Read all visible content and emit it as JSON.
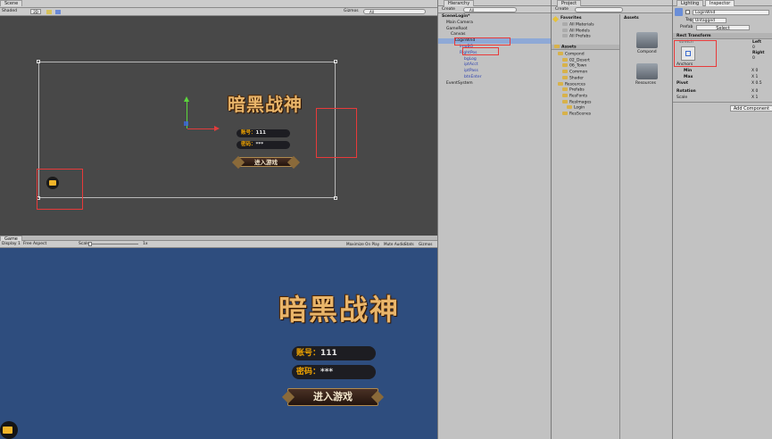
{
  "scene": {
    "tab": "Scene",
    "shading": "Shaded",
    "mode": "2D",
    "gizmos": "Gizmos",
    "search": "All"
  },
  "game": {
    "tab": "Game",
    "display": "Display 1",
    "aspect": "Free Aspect",
    "scale_label": "Scale",
    "scale_value": "1x",
    "toolbar_right": [
      "Maximize On Play",
      "Mute Audio",
      "Stats",
      "Gizmos"
    ]
  },
  "login_ui": {
    "logo": "暗黑战神",
    "account_label": "账号：",
    "account_value": "111",
    "password_label": "密码：",
    "password_value": "***",
    "enter_button": "进入游戏"
  },
  "hierarchy": {
    "tab": "Hierarchy",
    "create": "Create",
    "search": "All",
    "items": [
      {
        "label": "SceneLogin*",
        "depth": 0,
        "kind": "scene"
      },
      {
        "label": "Main Camera",
        "depth": 1
      },
      {
        "label": "GameRoot",
        "depth": 1
      },
      {
        "label": "Canvas",
        "depth": 2
      },
      {
        "label": "LoginWnd",
        "depth": 3,
        "selected": true
      },
      {
        "label": "imgBG",
        "depth": 4
      },
      {
        "label": "RightPos",
        "depth": 4
      },
      {
        "label": "bgLog",
        "depth": 5
      },
      {
        "label": "iptAcct",
        "depth": 5
      },
      {
        "label": "iptPass",
        "depth": 5
      },
      {
        "label": "btnEnter",
        "depth": 5
      },
      {
        "label": "EventSystem",
        "depth": 1
      }
    ]
  },
  "project": {
    "tab": "Project",
    "create": "Create",
    "favorites": "Favorites",
    "favorites_items": [
      "All Materials",
      "All Models",
      "All Prefabs"
    ],
    "assets": "Assets",
    "tree": [
      {
        "label": "Compond",
        "depth": 1
      },
      {
        "label": "02_Desert",
        "depth": 2
      },
      {
        "label": "06_Town",
        "depth": 2
      },
      {
        "label": "Common",
        "depth": 2
      },
      {
        "label": "Shader",
        "depth": 2
      },
      {
        "label": "Resources",
        "depth": 1
      },
      {
        "label": "Prefabs",
        "depth": 2
      },
      {
        "label": "ResFonts",
        "depth": 2
      },
      {
        "label": "ResImages",
        "depth": 2
      },
      {
        "label": "Login",
        "depth": 3
      },
      {
        "label": "ResScenes",
        "depth": 2
      }
    ],
    "grid_header": "Assets",
    "grid_items": [
      "Compond",
      "Resources"
    ]
  },
  "inspector": {
    "tabs": [
      "Lighting",
      "Inspector"
    ],
    "object_name": "LoginWnd",
    "tag_label": "Tag",
    "tag_value": "Untagged",
    "prefab_label": "Prefab",
    "prefab_select": "Select",
    "component": "Rect Transform",
    "stretch_label": "stretch",
    "left": {
      "label": "Left",
      "value": "0"
    },
    "right": {
      "label": "Right",
      "value": "0"
    },
    "top_value": "0",
    "bottom_value": "0",
    "anchors": "Anchors",
    "min": {
      "label": "Min",
      "x": "0",
      "y": "0"
    },
    "max": {
      "label": "Max",
      "x": "1",
      "y": "1"
    },
    "pivot": {
      "label": "Pivot",
      "x": "0.5"
    },
    "rotation_label": "Rotation",
    "rotation_x": "0",
    "scale_label": "Scale",
    "scale_x": "1",
    "add_component": "Add Component"
  }
}
